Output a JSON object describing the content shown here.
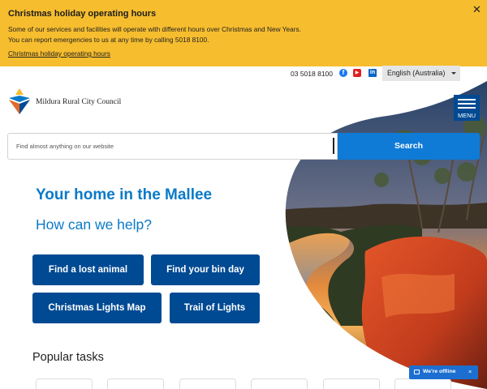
{
  "alert": {
    "title": "Christmas holiday operating hours",
    "line1": "Some of our services and facilities will operate with different hours over Christmas and New Years.",
    "line2": "You can report emergencies to us at any time by calling 5018 8100.",
    "link": "Christmas holiday operating hours",
    "close": "✕"
  },
  "utility": {
    "phone": "03 5018 8100",
    "social": {
      "facebook": "f",
      "youtube": "▶",
      "linkedin": "in"
    },
    "language": "English (Australia)"
  },
  "logo": {
    "name": "Mildura Rural City Council"
  },
  "menu": {
    "label": "MENU"
  },
  "search": {
    "placeholder": "Find almost anything on our website",
    "button": "Search"
  },
  "hero": {
    "heading": "Your home in the Mallee",
    "subheading": "How can we help?"
  },
  "quick_links": [
    "Find a lost animal",
    "Find your bin day",
    "Christmas Lights Map",
    "Trail of Lights"
  ],
  "popular": {
    "title": "Popular tasks"
  },
  "chat": {
    "status": "We're offline",
    "close": "×"
  },
  "colors": {
    "alert_bg": "#f6bd2e",
    "brand_blue": "#004a93",
    "accent_blue": "#0f7bd6",
    "heading_blue": "#0b7ac8"
  },
  "icons": {
    "alert_close": "close-icon",
    "caret": "chevron-down-icon",
    "menu": "hamburger-icon",
    "chat": "chat-bubble-icon"
  }
}
